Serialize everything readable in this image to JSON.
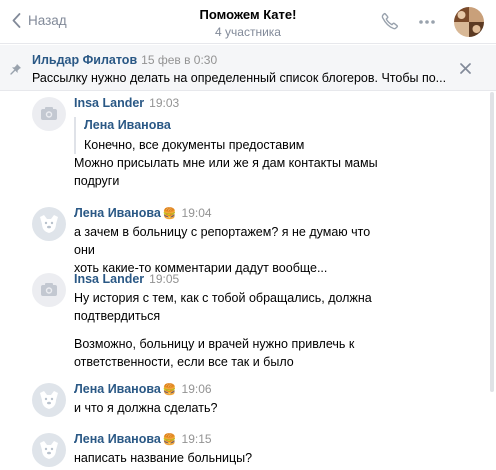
{
  "header": {
    "back_label": "Назад",
    "title": "Поможем Кате!",
    "subtitle": "4 участника"
  },
  "pinned": {
    "author": "Ильдар Филатов",
    "date": "15 фев в 0:30",
    "text": "Рассылку нужно делать на определенный список блогеров. Чтобы по..."
  },
  "messages": [
    {
      "author": "Insa Lander",
      "time": "19:03",
      "emoji": "",
      "avatar": "camera",
      "quote": {
        "author": "Лена Иванова",
        "text": "Конечно, все документы предоставим"
      },
      "lines": [
        "Можно присылать мне или же я дам контакты мамы",
        "подруги"
      ]
    },
    {
      "author": "Лена Иванова",
      "time": "19:04",
      "emoji": "🍔",
      "avatar": "dog",
      "lines": [
        "а зачем в больницу с репортажем? я не думаю что они",
        "хоть какие-то комментарии дадут вообще..."
      ]
    },
    {
      "author": "Insa Lander",
      "time": "19:05",
      "emoji": "",
      "avatar": "camera",
      "lines": [
        "Ну история с тем, как с тобой обращались, должна",
        "подтвердиться"
      ],
      "lines2": [
        "Возможно, больницу и врачей нужно привлечь к",
        "ответственности, если все так и было"
      ]
    },
    {
      "author": "Лена Иванова",
      "time": "19:06",
      "emoji": "🍔",
      "avatar": "dog",
      "lines": [
        "и что я должна сделать?"
      ]
    },
    {
      "author": "Лена Иванова",
      "time": "19:15",
      "emoji": "🍔",
      "avatar": "dog",
      "lines": [
        "написать название больницы?"
      ]
    }
  ],
  "icons": {
    "back": "chevron-left-icon",
    "call": "phone-icon",
    "more": "more-horizontal-icon",
    "pin": "pin-icon",
    "close": "close-icon",
    "camera_avatar": "camera-icon",
    "dog_avatar": "vk-dog-icon"
  },
  "colors": {
    "link": "#2a5885",
    "secondary": "#828a99",
    "pinned_bg": "#f5f6f8",
    "avatar_bg": "#ecedf1",
    "dog_avatar_bg": "#dfe4ea"
  }
}
